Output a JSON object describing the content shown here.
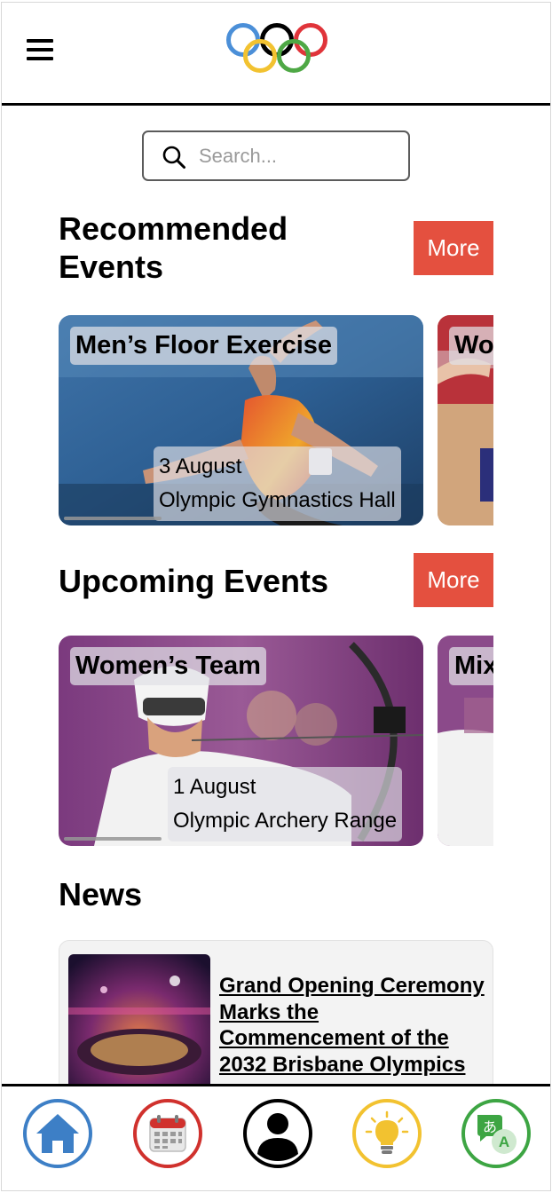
{
  "header": {
    "menu_icon": "hamburger-menu-icon",
    "logo_icon": "olympic-rings-logo"
  },
  "search": {
    "placeholder": "Search...",
    "icon": "search-icon"
  },
  "recommended": {
    "title": "Recommended Events",
    "more_label": "More",
    "cards": [
      {
        "title": "Men’s Floor Exercise",
        "date": "3 August",
        "venue": "Olympic Gymnastics Hall"
      },
      {
        "title": "Wo"
      }
    ]
  },
  "upcoming": {
    "title": "Upcoming Events",
    "more_label": "More",
    "cards": [
      {
        "title": "Women’s Team",
        "date": "1 August",
        "venue": "Olympic Archery Range"
      },
      {
        "title": "Mix"
      }
    ]
  },
  "news": {
    "title": "News",
    "items": [
      {
        "headline": "Grand Opening Ceremony Marks the Commencement of the 2032 Brisbane Olympics"
      }
    ]
  },
  "bottom_nav": {
    "items": [
      {
        "icon": "home-icon",
        "color": "#3d7fc6"
      },
      {
        "icon": "calendar-icon",
        "color": "#d0312d"
      },
      {
        "icon": "profile-icon",
        "color": "#000000"
      },
      {
        "icon": "lightbulb-icon",
        "color": "#f2c230"
      },
      {
        "icon": "translate-icon",
        "color": "#3da543"
      }
    ]
  },
  "colors": {
    "accent": "#e4503f",
    "ring_blue": "#4b8fd8",
    "ring_yellow": "#f2c230",
    "ring_black": "#000000",
    "ring_green": "#4ea845",
    "ring_red": "#e0343a"
  }
}
